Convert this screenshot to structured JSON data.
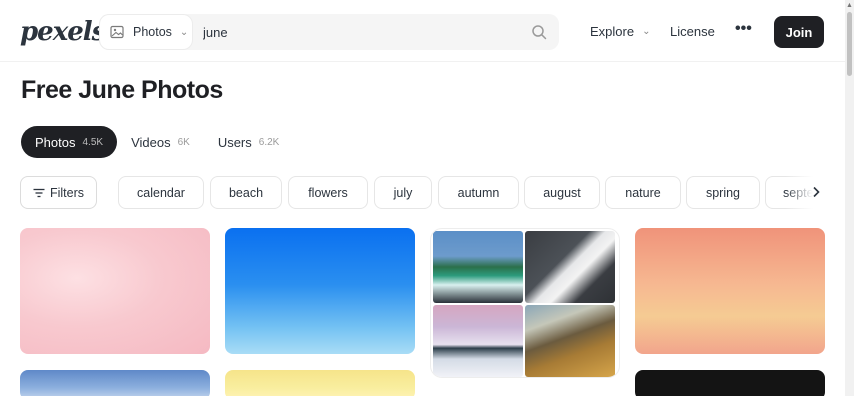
{
  "header": {
    "logo": "pexels",
    "search": {
      "type_label": "Photos",
      "value": "june",
      "type_icon": "image-icon",
      "search_icon": "search-icon"
    },
    "nav": {
      "explore": "Explore",
      "license": "License",
      "more": "•••",
      "join": "Join"
    }
  },
  "page": {
    "title": "Free June Photos"
  },
  "tabs": [
    {
      "label": "Photos",
      "count": "4.5K",
      "active": true
    },
    {
      "label": "Videos",
      "count": "6K",
      "active": false
    },
    {
      "label": "Users",
      "count": "6.2K",
      "active": false
    }
  ],
  "filters": {
    "label": "Filters",
    "chips": [
      "calendar",
      "beach",
      "flowers",
      "july",
      "autumn",
      "august",
      "nature",
      "spring",
      "septe"
    ]
  },
  "colors": {
    "dark": "#1f2024",
    "text": "#2c343e",
    "border": "#dcdcdc"
  }
}
